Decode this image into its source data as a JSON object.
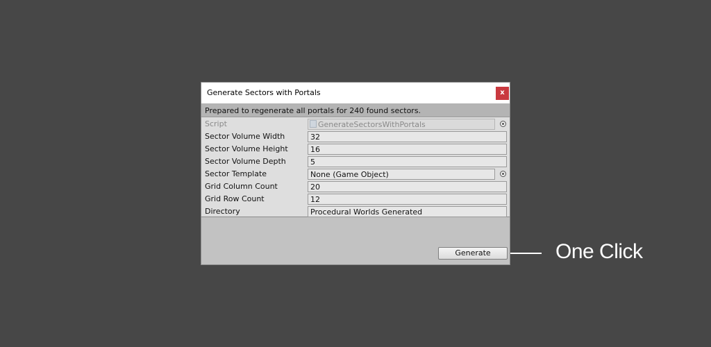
{
  "window": {
    "title": "Generate Sectors with Portals",
    "close_label": "x",
    "status_message": "Prepared to regenerate all portals for 240 found sectors."
  },
  "fields": [
    {
      "label": "Script",
      "value": "GenerateSectorsWithPortals",
      "disabled": true,
      "object_picker": true
    },
    {
      "label": "Sector Volume Width",
      "value": "32"
    },
    {
      "label": "Sector Volume Height",
      "value": "16"
    },
    {
      "label": "Sector Volume Depth",
      "value": "5"
    },
    {
      "label": "Sector Template",
      "value": "None (Game Object)",
      "object_picker": true
    },
    {
      "label": "Grid Column Count",
      "value": "20"
    },
    {
      "label": "Grid Row Count",
      "value": "12"
    },
    {
      "label": "Directory",
      "value": "Procedural Worlds Generated"
    }
  ],
  "actions": {
    "generate_label": "Generate"
  },
  "callout": {
    "text": "One Click",
    "color": "#ffffff"
  },
  "colors": {
    "background": "#474747",
    "close_button": "#c9393f"
  }
}
